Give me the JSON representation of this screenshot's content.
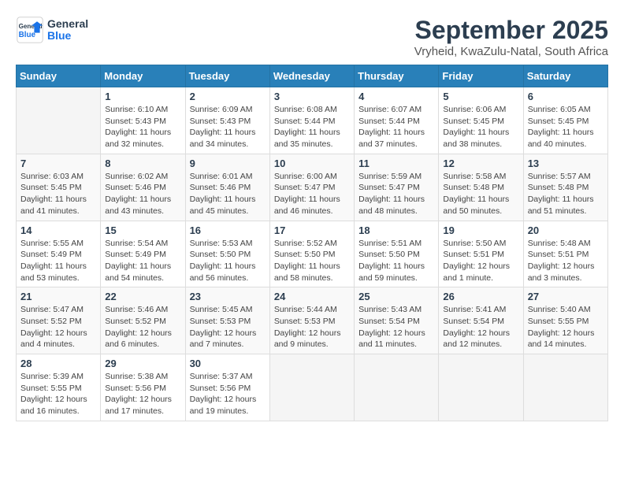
{
  "header": {
    "logo_general": "General",
    "logo_blue": "Blue",
    "month_title": "September 2025",
    "location": "Vryheid, KwaZulu-Natal, South Africa"
  },
  "weekdays": [
    "Sunday",
    "Monday",
    "Tuesday",
    "Wednesday",
    "Thursday",
    "Friday",
    "Saturday"
  ],
  "weeks": [
    [
      {
        "day": "",
        "info": ""
      },
      {
        "day": "1",
        "info": "Sunrise: 6:10 AM\nSunset: 5:43 PM\nDaylight: 11 hours\nand 32 minutes."
      },
      {
        "day": "2",
        "info": "Sunrise: 6:09 AM\nSunset: 5:43 PM\nDaylight: 11 hours\nand 34 minutes."
      },
      {
        "day": "3",
        "info": "Sunrise: 6:08 AM\nSunset: 5:44 PM\nDaylight: 11 hours\nand 35 minutes."
      },
      {
        "day": "4",
        "info": "Sunrise: 6:07 AM\nSunset: 5:44 PM\nDaylight: 11 hours\nand 37 minutes."
      },
      {
        "day": "5",
        "info": "Sunrise: 6:06 AM\nSunset: 5:45 PM\nDaylight: 11 hours\nand 38 minutes."
      },
      {
        "day": "6",
        "info": "Sunrise: 6:05 AM\nSunset: 5:45 PM\nDaylight: 11 hours\nand 40 minutes."
      }
    ],
    [
      {
        "day": "7",
        "info": "Sunrise: 6:03 AM\nSunset: 5:45 PM\nDaylight: 11 hours\nand 41 minutes."
      },
      {
        "day": "8",
        "info": "Sunrise: 6:02 AM\nSunset: 5:46 PM\nDaylight: 11 hours\nand 43 minutes."
      },
      {
        "day": "9",
        "info": "Sunrise: 6:01 AM\nSunset: 5:46 PM\nDaylight: 11 hours\nand 45 minutes."
      },
      {
        "day": "10",
        "info": "Sunrise: 6:00 AM\nSunset: 5:47 PM\nDaylight: 11 hours\nand 46 minutes."
      },
      {
        "day": "11",
        "info": "Sunrise: 5:59 AM\nSunset: 5:47 PM\nDaylight: 11 hours\nand 48 minutes."
      },
      {
        "day": "12",
        "info": "Sunrise: 5:58 AM\nSunset: 5:48 PM\nDaylight: 11 hours\nand 50 minutes."
      },
      {
        "day": "13",
        "info": "Sunrise: 5:57 AM\nSunset: 5:48 PM\nDaylight: 11 hours\nand 51 minutes."
      }
    ],
    [
      {
        "day": "14",
        "info": "Sunrise: 5:55 AM\nSunset: 5:49 PM\nDaylight: 11 hours\nand 53 minutes."
      },
      {
        "day": "15",
        "info": "Sunrise: 5:54 AM\nSunset: 5:49 PM\nDaylight: 11 hours\nand 54 minutes."
      },
      {
        "day": "16",
        "info": "Sunrise: 5:53 AM\nSunset: 5:50 PM\nDaylight: 11 hours\nand 56 minutes."
      },
      {
        "day": "17",
        "info": "Sunrise: 5:52 AM\nSunset: 5:50 PM\nDaylight: 11 hours\nand 58 minutes."
      },
      {
        "day": "18",
        "info": "Sunrise: 5:51 AM\nSunset: 5:50 PM\nDaylight: 11 hours\nand 59 minutes."
      },
      {
        "day": "19",
        "info": "Sunrise: 5:50 AM\nSunset: 5:51 PM\nDaylight: 12 hours\nand 1 minute."
      },
      {
        "day": "20",
        "info": "Sunrise: 5:48 AM\nSunset: 5:51 PM\nDaylight: 12 hours\nand 3 minutes."
      }
    ],
    [
      {
        "day": "21",
        "info": "Sunrise: 5:47 AM\nSunset: 5:52 PM\nDaylight: 12 hours\nand 4 minutes."
      },
      {
        "day": "22",
        "info": "Sunrise: 5:46 AM\nSunset: 5:52 PM\nDaylight: 12 hours\nand 6 minutes."
      },
      {
        "day": "23",
        "info": "Sunrise: 5:45 AM\nSunset: 5:53 PM\nDaylight: 12 hours\nand 7 minutes."
      },
      {
        "day": "24",
        "info": "Sunrise: 5:44 AM\nSunset: 5:53 PM\nDaylight: 12 hours\nand 9 minutes."
      },
      {
        "day": "25",
        "info": "Sunrise: 5:43 AM\nSunset: 5:54 PM\nDaylight: 12 hours\nand 11 minutes."
      },
      {
        "day": "26",
        "info": "Sunrise: 5:41 AM\nSunset: 5:54 PM\nDaylight: 12 hours\nand 12 minutes."
      },
      {
        "day": "27",
        "info": "Sunrise: 5:40 AM\nSunset: 5:55 PM\nDaylight: 12 hours\nand 14 minutes."
      }
    ],
    [
      {
        "day": "28",
        "info": "Sunrise: 5:39 AM\nSunset: 5:55 PM\nDaylight: 12 hours\nand 16 minutes."
      },
      {
        "day": "29",
        "info": "Sunrise: 5:38 AM\nSunset: 5:56 PM\nDaylight: 12 hours\nand 17 minutes."
      },
      {
        "day": "30",
        "info": "Sunrise: 5:37 AM\nSunset: 5:56 PM\nDaylight: 12 hours\nand 19 minutes."
      },
      {
        "day": "",
        "info": ""
      },
      {
        "day": "",
        "info": ""
      },
      {
        "day": "",
        "info": ""
      },
      {
        "day": "",
        "info": ""
      }
    ]
  ]
}
